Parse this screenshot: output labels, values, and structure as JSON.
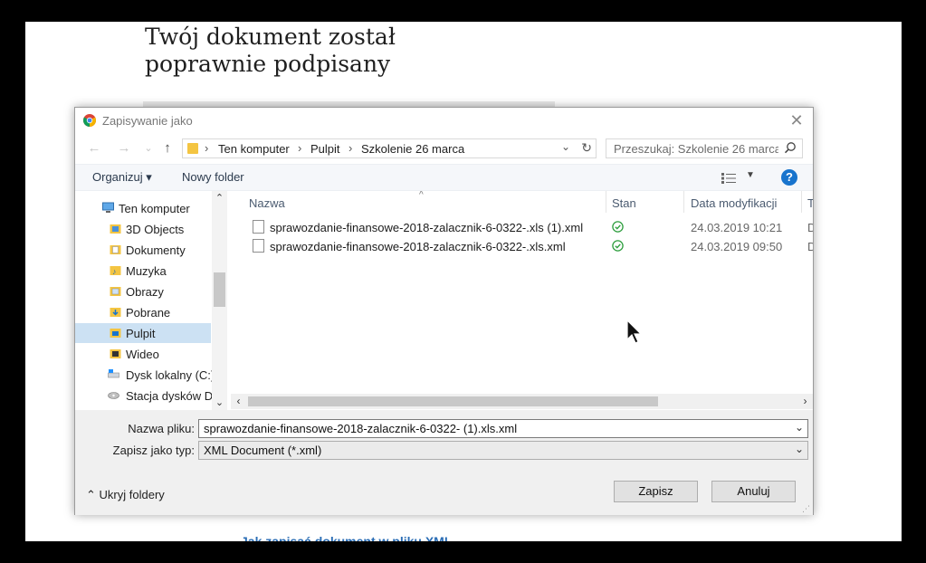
{
  "page": {
    "heading_line1": "Twój dokument został",
    "heading_line2": "poprawnie podpisany",
    "link_text": "Jak zapisać dokument w pliku XML"
  },
  "dialog": {
    "title": "Zapisywanie jako",
    "address": {
      "crumbs": [
        "Ten komputer",
        "Pulpit",
        "Szkolenie 26 marca"
      ]
    },
    "search_placeholder": "Przeszukaj: Szkolenie 26 marca",
    "toolbar": {
      "organize_label": "Organizuj ▾",
      "new_folder_label": "Nowy folder"
    },
    "nav_items": [
      {
        "label": "Ten komputer",
        "icon": "computer-icon"
      },
      {
        "label": "3D Objects",
        "icon": "3d-objects-icon"
      },
      {
        "label": "Dokumenty",
        "icon": "documents-icon"
      },
      {
        "label": "Muzyka",
        "icon": "music-icon"
      },
      {
        "label": "Obrazy",
        "icon": "pictures-icon"
      },
      {
        "label": "Pobrane",
        "icon": "downloads-icon"
      },
      {
        "label": "Pulpit",
        "icon": "desktop-icon",
        "selected": true
      },
      {
        "label": "Wideo",
        "icon": "video-icon"
      },
      {
        "label": "Dysk lokalny (C:)",
        "icon": "local-disk-icon"
      },
      {
        "label": "Stacja dysków D",
        "icon": "drive-icon"
      }
    ],
    "columns": {
      "name": "Nazwa",
      "status": "Stan",
      "modified": "Data modyfikacji",
      "type": "T"
    },
    "files": [
      {
        "name": "sprawozdanie-finansowe-2018-zalacznik-6-0322-.xls (1).xml",
        "status": "synced-check-icon",
        "modified": "24.03.2019 10:21",
        "type": "D"
      },
      {
        "name": "sprawozdanie-finansowe-2018-zalacznik-6-0322-.xls.xml",
        "status": "synced-check-icon",
        "modified": "24.03.2019 09:50",
        "type": "D"
      }
    ],
    "filename_label": "Nazwa pliku:",
    "filename_value": "sprawozdanie-finansowe-2018-zalacznik-6-0322- (1).xls.xml",
    "filetype_label": "Zapisz jako typ:",
    "filetype_value": "XML Document (*.xml)",
    "hide_folders_label": "Ukryj foldery",
    "save_label": "Zapisz",
    "cancel_label": "Anuluj"
  },
  "colors": {
    "accent": "#1874cd",
    "selection": "#cce1f3",
    "status_green": "#2e9e3e",
    "link": "#2a6db5"
  }
}
